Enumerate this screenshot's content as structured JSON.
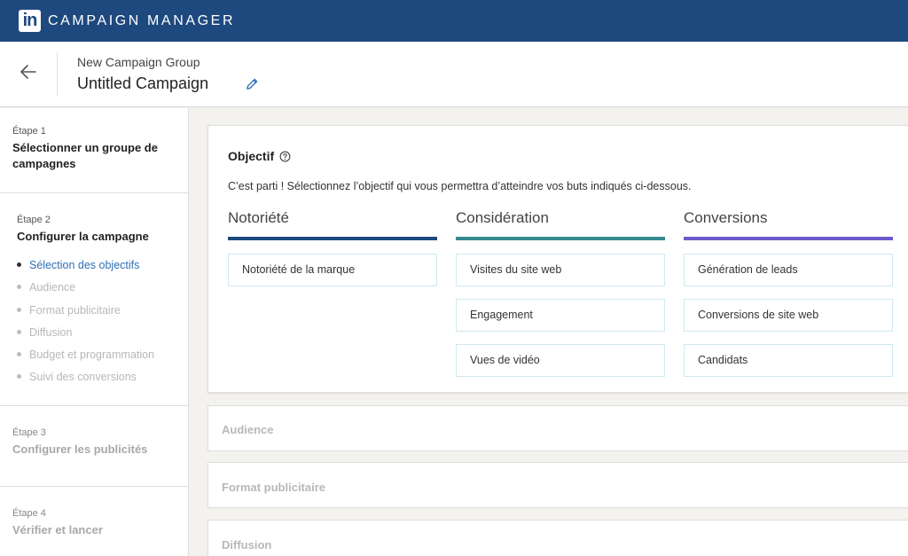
{
  "app": {
    "logo": "in",
    "name": "CAMPAIGN MANAGER"
  },
  "header": {
    "group": "New Campaign Group",
    "title": "Untitled Campaign",
    "back_icon": "arrow-left-icon",
    "edit_icon": "pencil-icon"
  },
  "sidebar": {
    "steps": [
      {
        "label": "Étape 1",
        "title": "Sélectionner un groupe de campagnes"
      },
      {
        "label": "Étape 2",
        "title": "Configurer la campagne",
        "items": [
          "Sélection des objectifs",
          "Audience",
          "Format publicitaire",
          "Diffusion",
          "Budget et programmation",
          "Suivi des conversions"
        ]
      },
      {
        "label": "Étape 3",
        "title": "Configurer les publicités"
      },
      {
        "label": "Étape 4",
        "title": "Vérifier et lancer"
      }
    ]
  },
  "objective": {
    "title": "Objectif",
    "description": "C’est parti ! Sélectionnez l’objectif qui vous permettra d’atteindre vos buts indiqués ci-dessous.",
    "columns": [
      {
        "title": "Notoriété",
        "color": "#1e497f",
        "options": [
          "Notoriété de la marque"
        ]
      },
      {
        "title": "Considération",
        "color": "#35898f",
        "options": [
          "Visites du site web",
          "Engagement",
          "Vues de vidéo"
        ]
      },
      {
        "title": "Conversions",
        "color": "#6b5ccc",
        "options": [
          "Génération de leads",
          "Conversions de site web",
          "Candidats"
        ]
      }
    ]
  },
  "sections": [
    "Audience",
    "Format publicitaire",
    "Diffusion"
  ],
  "colors": {
    "brand": "#1e497f",
    "active_link": "#2e6fb6"
  }
}
